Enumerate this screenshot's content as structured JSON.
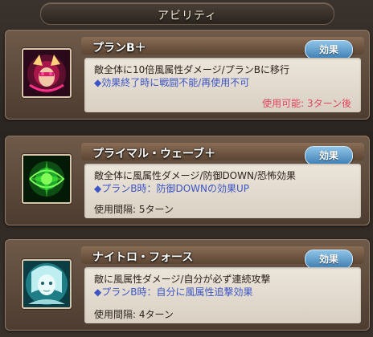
{
  "header": {
    "title": "アビリティ"
  },
  "abilities": [
    {
      "name": "プランB＋",
      "effect_label": "効果",
      "desc": "敵全体に10倍風属性ダメージ/プランBに移行",
      "note": "◆効果終了時に戦闘不能/再使用不可",
      "cooldown": "使用可能: 3ターン後",
      "icon": "red-demon-portrait-icon"
    },
    {
      "name": "プライマル・ウェーブ＋",
      "effect_label": "効果",
      "desc": "敵全体に風属性ダメージ/防御DOWN/恐怖効果",
      "note": "◆プランB時：防御DOWNの効果UP",
      "interval": "使用間隔: 5ターン",
      "icon": "green-wave-icon"
    },
    {
      "name": "ナイトロ・フォース",
      "effect_label": "効果",
      "desc": "敵に風属性ダメージ/自分が必ず連続攻撃",
      "note": "◆プランB時：自分に風属性追撃効果",
      "interval": "使用間隔: 4ターン",
      "icon": "cyan-character-portrait-icon"
    }
  ],
  "colors": {
    "effect_button": "#5a9bd0",
    "note_text": "#3c55c6",
    "cooldown_text": "#e2465f"
  }
}
